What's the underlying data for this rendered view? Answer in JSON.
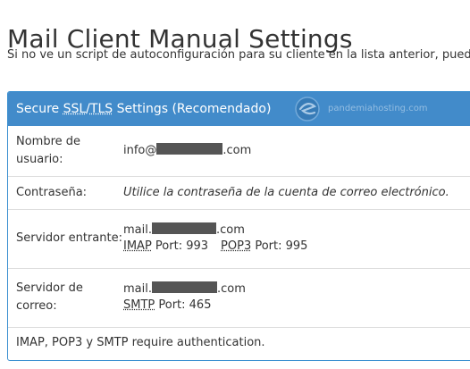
{
  "page": {
    "title": "Mail Client Manual Settings",
    "subtitle": "Si no ve un script de autoconfiguración para su cliente en la lista anterior, puede"
  },
  "panel": {
    "header_prefix": "Secure ",
    "header_ssl": "SSL",
    "header_slash": "/",
    "header_tls": "TLS",
    "header_suffix": " Settings (Recomendado)",
    "watermark": "pandemiahosting.com"
  },
  "rows": {
    "username": {
      "label": "Nombre de usuario:",
      "value_prefix": "info@",
      "value_suffix": ".com"
    },
    "password": {
      "label": "Contraseña:",
      "value": "Utilice la contraseña de la cuenta de correo electrónico."
    },
    "incoming": {
      "label": "Servidor entrante:",
      "host_prefix": "mail.",
      "host_suffix": ".com",
      "imap_label": "IMAP",
      "imap_port_text": " Port: 993",
      "pop3_label": "POP3",
      "pop3_port_text": " Port: 995"
    },
    "outgoing": {
      "label": "Servidor de correo:",
      "host_prefix": "mail.",
      "host_suffix": ".com",
      "smtp_label": "SMTP",
      "smtp_port_text": " Port: 465"
    }
  },
  "footnote": "IMAP, POP3 y SMTP require authentication.",
  "colors": {
    "header_bg": "#428bca",
    "border": "#3a8fd0",
    "redaction": "#555555"
  }
}
